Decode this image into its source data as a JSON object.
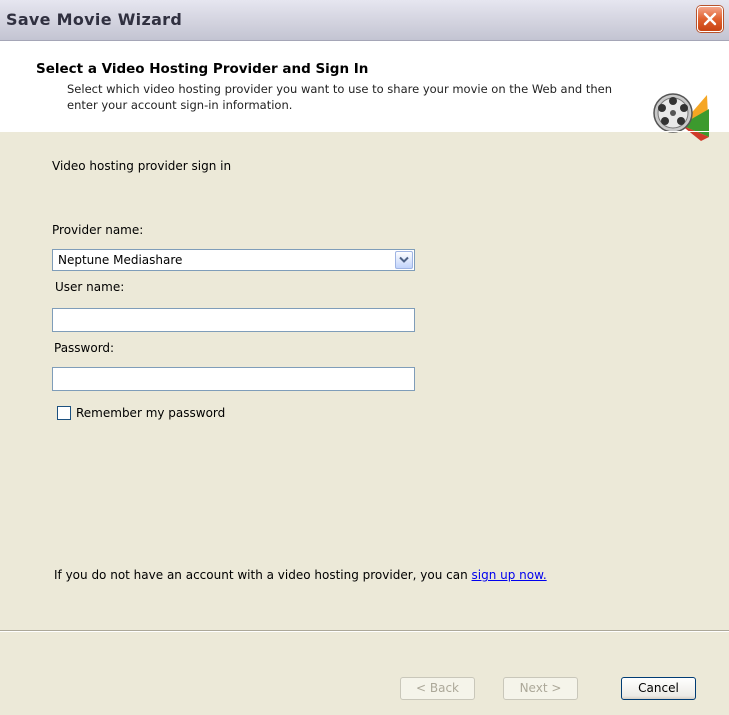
{
  "window": {
    "title": "Save Movie Wizard",
    "close_icon": "close-icon",
    "accent_close": "#e0612f"
  },
  "header": {
    "title": "Select a Video Hosting Provider and Sign In",
    "description": "Select which video hosting provider you want to use to share your movie on the Web and then enter your account sign-in information.",
    "icon": "film-reel-icon"
  },
  "form": {
    "section_label": "Video hosting provider sign in",
    "provider_label": "Provider name:",
    "provider_value": "Neptune Mediashare",
    "username_label": "User name:",
    "username_value": "",
    "password_label": "Password:",
    "password_value": "",
    "remember_label": "Remember my password",
    "remember_checked": false
  },
  "signup": {
    "text": "If you do not have an account with a video hosting provider, you can ",
    "link_text": "sign up now."
  },
  "buttons": {
    "back": "< Back",
    "next": "Next >",
    "cancel": "Cancel"
  }
}
